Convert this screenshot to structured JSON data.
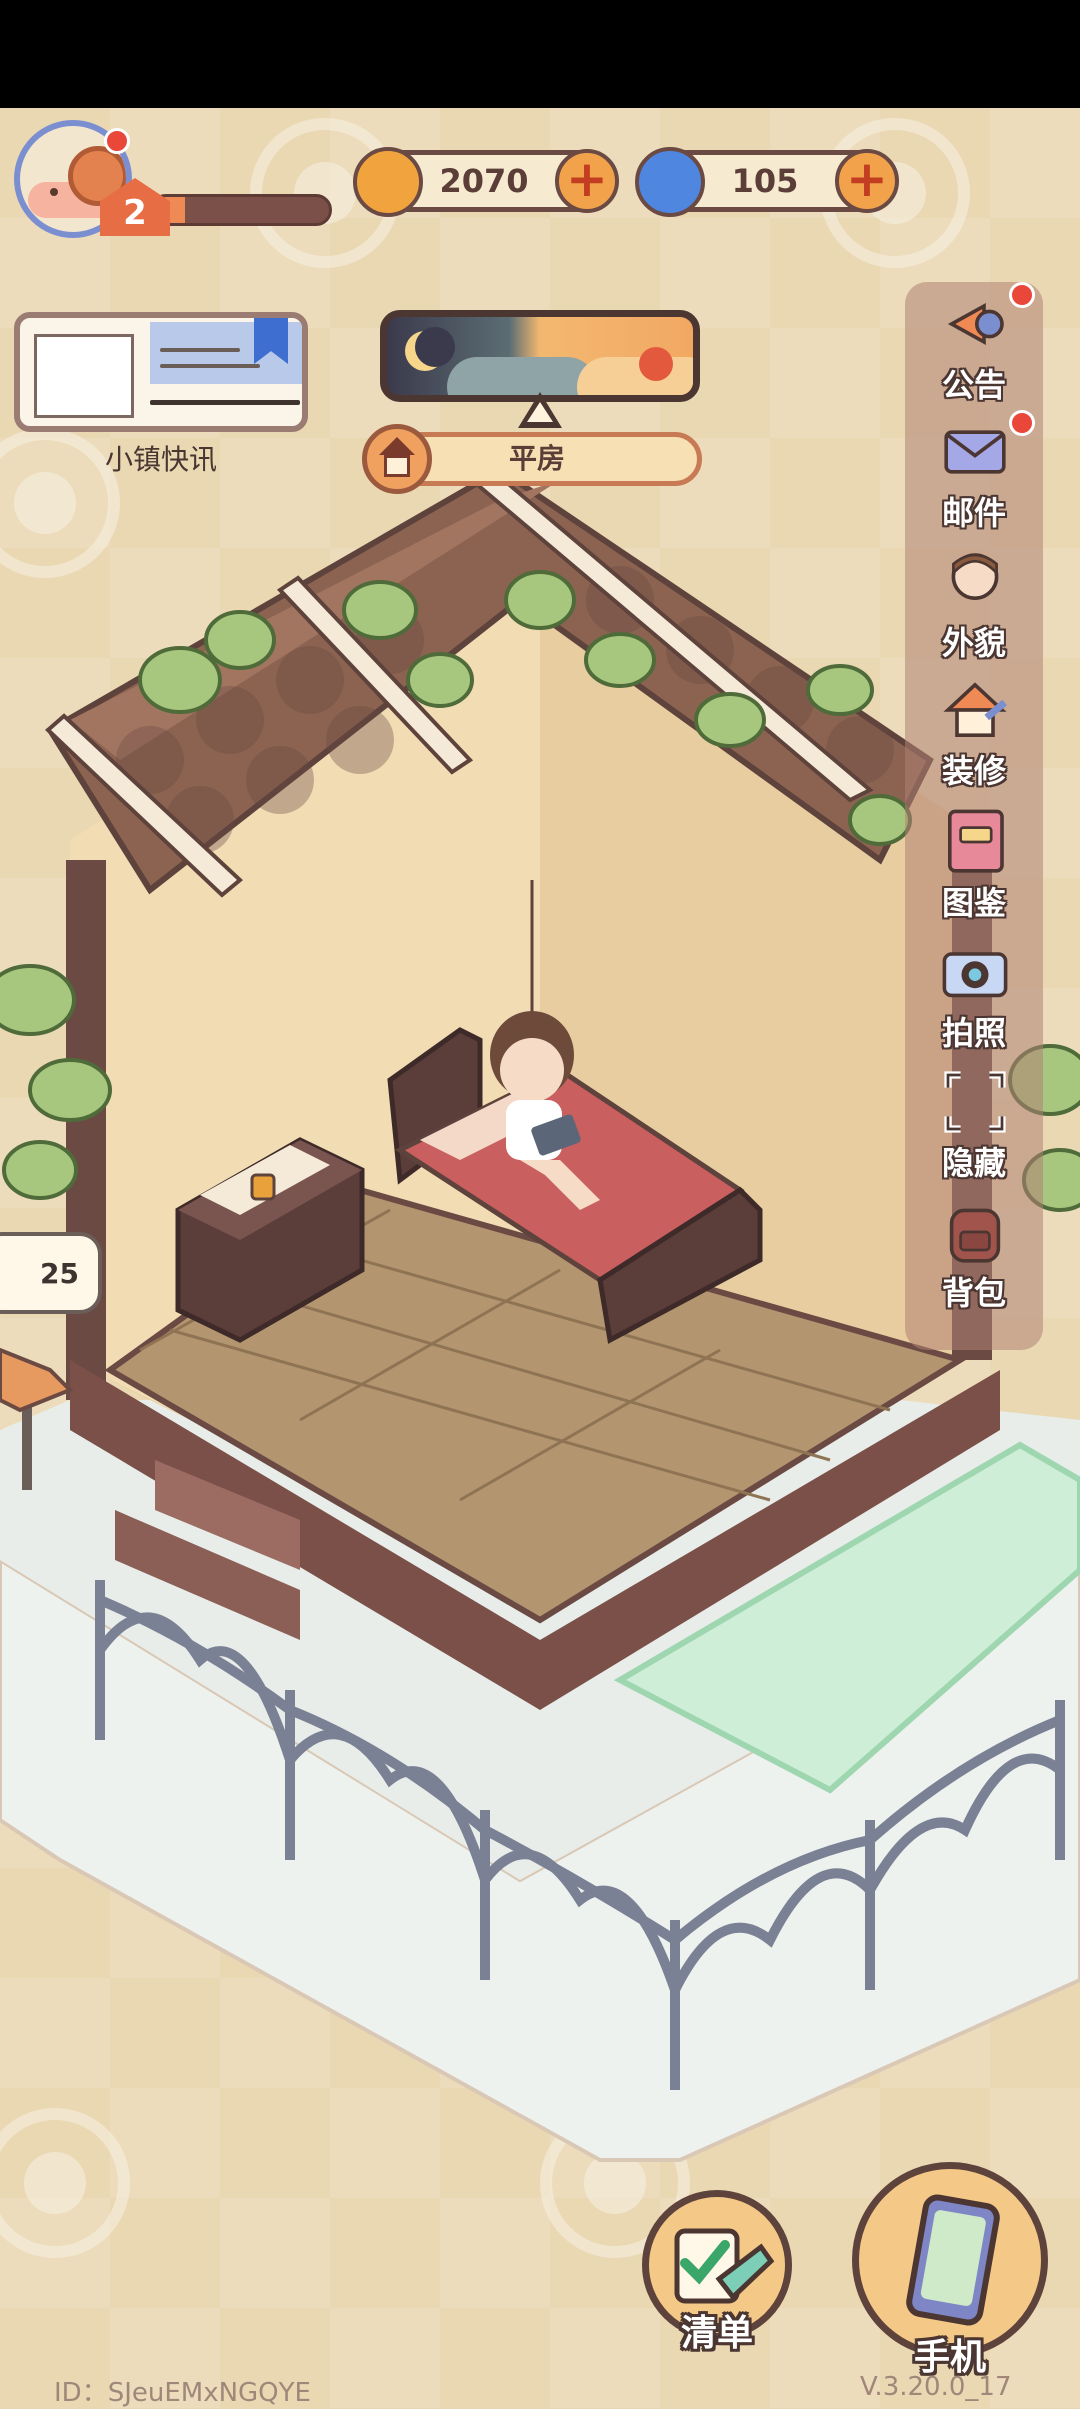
{
  "hud": {
    "level": "2",
    "xp_fraction": 0.18,
    "coins": "2070",
    "gems": "105",
    "plus": "+"
  },
  "news": {
    "label": "小镇快讯"
  },
  "house": {
    "name": "平房"
  },
  "menu": {
    "items": [
      {
        "label": "公告",
        "icon": "announcement-icon",
        "badge": true
      },
      {
        "label": "邮件",
        "icon": "mail-icon",
        "badge": true
      },
      {
        "label": "外貌",
        "icon": "appearance-icon",
        "badge": false
      },
      {
        "label": "装修",
        "icon": "decorate-icon",
        "badge": false
      },
      {
        "label": "图鉴",
        "icon": "collection-book-icon",
        "badge": false
      },
      {
        "label": "拍照",
        "icon": "camera-icon",
        "badge": false
      },
      {
        "label": "隐藏",
        "icon": "hide-ui-icon",
        "badge": false
      },
      {
        "label": "背包",
        "icon": "backpack-icon",
        "badge": false
      }
    ]
  },
  "bubble": {
    "count": "25"
  },
  "bottom": {
    "checklist_label": "清单",
    "phone_label": "手机"
  },
  "footer": {
    "id": "ID：SJeuEMxNGQYE",
    "version": "V.3.20.0_17"
  },
  "colors": {
    "accent": "#f08a55",
    "outline": "#4b3632",
    "badge": "#e8473a"
  }
}
